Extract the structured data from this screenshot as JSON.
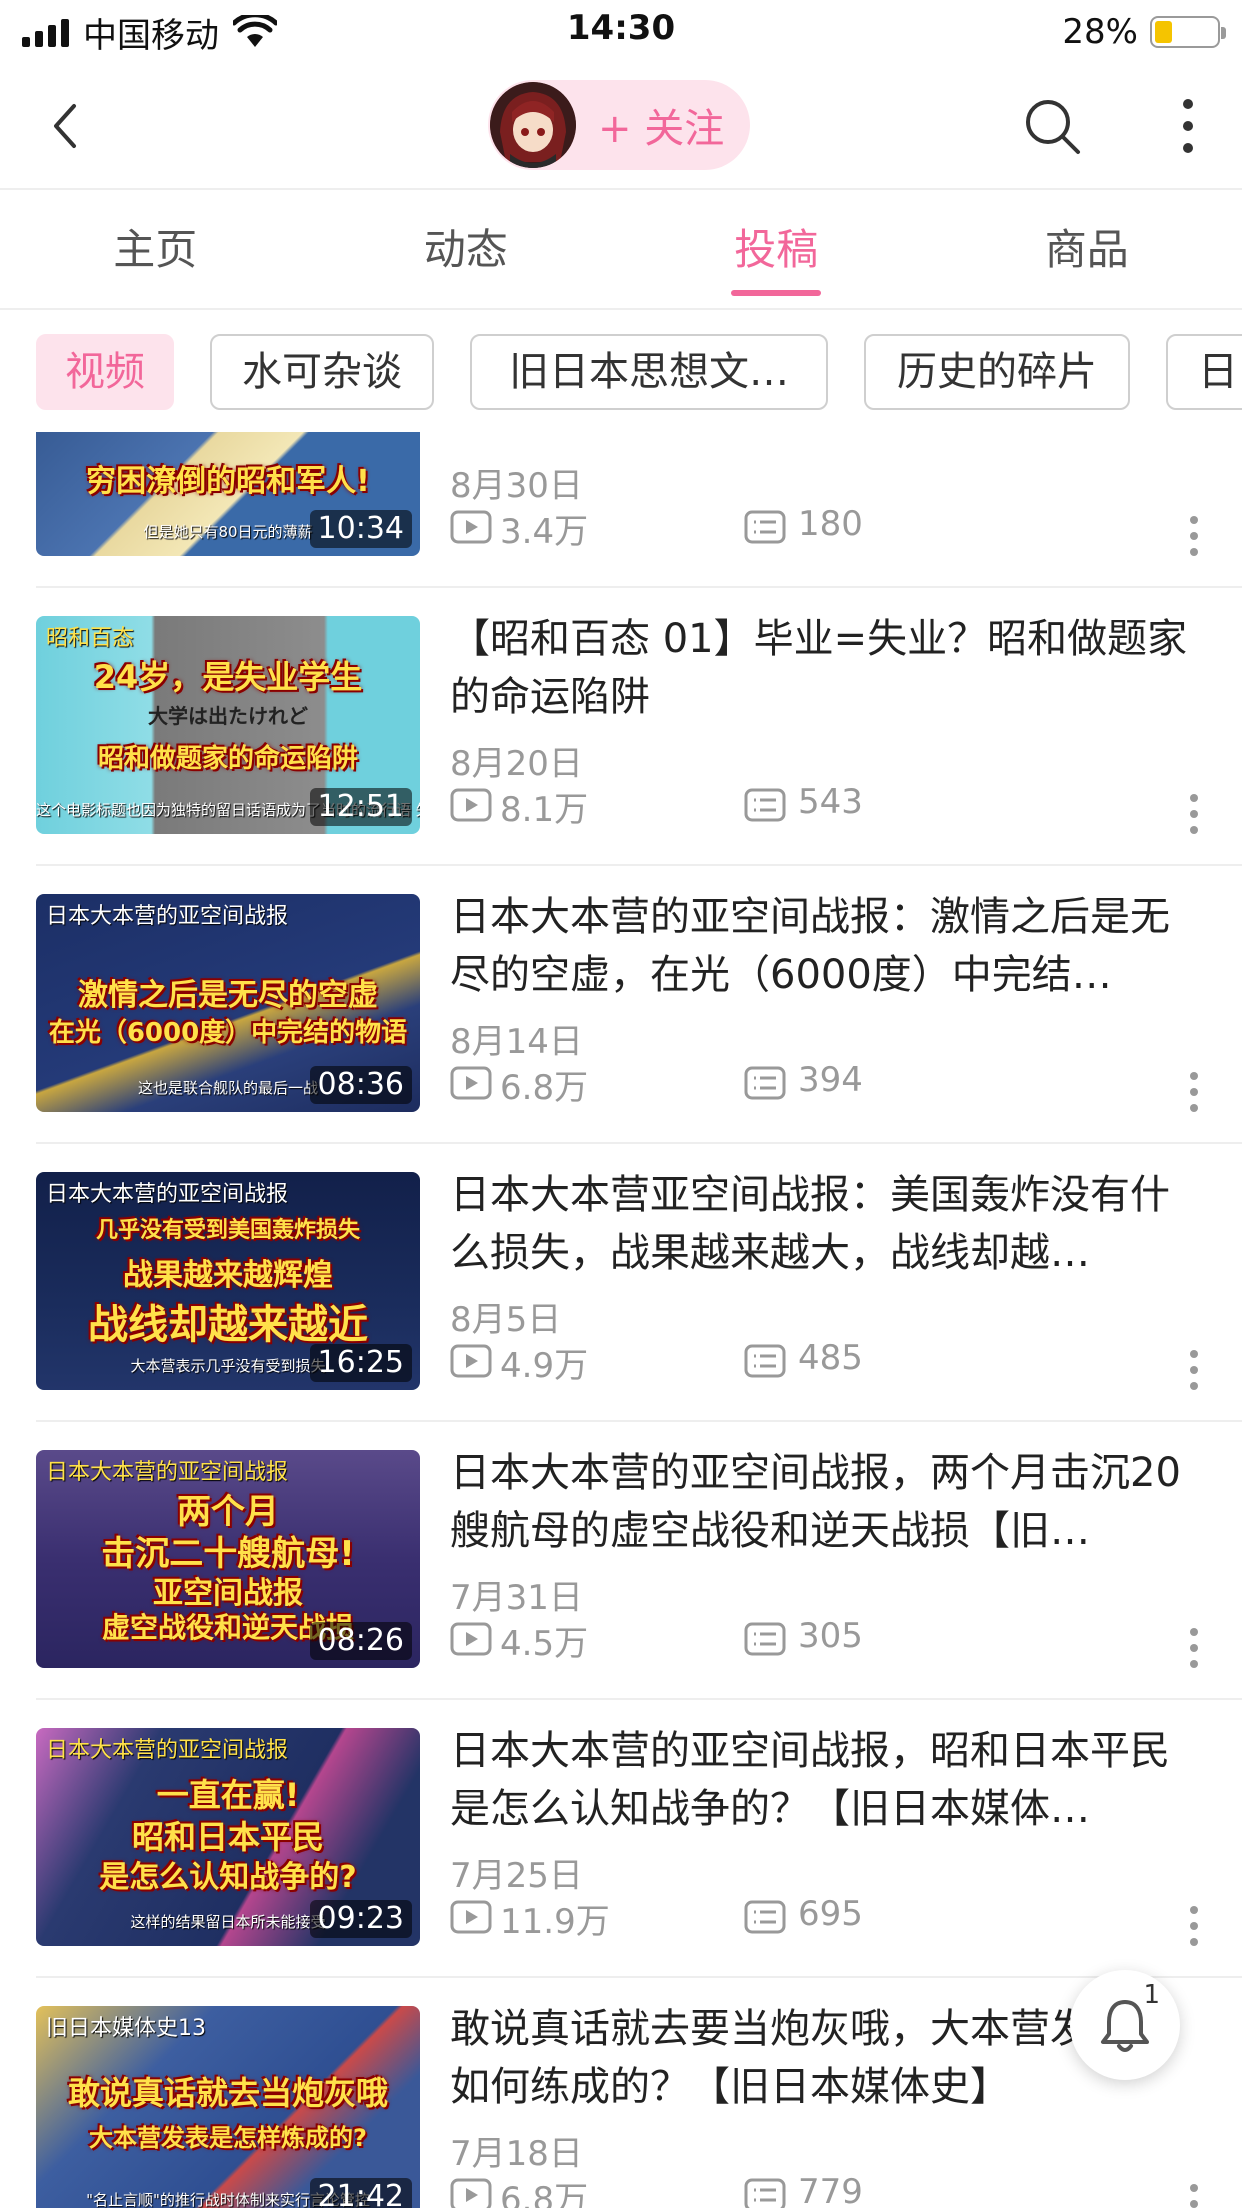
{
  "status_bar": {
    "carrier": "中国移动",
    "time": "14:30",
    "battery_percent": "28%",
    "battery_level": 0.28,
    "battery_color": "#f5c400"
  },
  "header": {
    "follow_label": "+ 关注",
    "back_icon": "chevron-left-icon",
    "search_icon": "search-icon",
    "more_icon": "more-vertical-icon",
    "accent_color": "#f2679a"
  },
  "tabs": [
    {
      "label": "主页",
      "active": false
    },
    {
      "label": "动态",
      "active": false
    },
    {
      "label": "投稿",
      "active": true
    },
    {
      "label": "商品",
      "active": false
    }
  ],
  "chips": [
    {
      "label": "视频",
      "active": true
    },
    {
      "label": "水可杂谈",
      "active": false
    },
    {
      "label": "旧日本思想文…",
      "active": false
    },
    {
      "label": "历史的碎片",
      "active": false
    },
    {
      "label": "日",
      "active": false
    }
  ],
  "videos": [
    {
      "thumb_tag": "",
      "thumb_lines": [
        "穷困潦倒的昭和军人!"
      ],
      "thumb_sub": "但是她只有80日元的薄薪",
      "duration": "10:34",
      "title": "",
      "date": "8月30日",
      "views": "3.4万",
      "comments": "180"
    },
    {
      "thumb_tag": "昭和百态",
      "thumb_lines": [
        "24岁，是失业学生",
        "大学は出たけれど",
        "昭和做题家的命运陷阱"
      ],
      "thumb_sub": "这个电影标题也因为独特的留日话语成为了当时的流行语 失排",
      "duration": "12:51",
      "title": "【昭和百态 01】毕业=失业？昭和做题家的命运陷阱",
      "date": "8月20日",
      "views": "8.1万",
      "comments": "543"
    },
    {
      "thumb_tag": "日本大本营的亚空间战报",
      "thumb_lines": [
        "激情之后是无尽的空虚",
        "在光（6000度）中完结的物语"
      ],
      "thumb_sub": "这也是联合舰队的最后一战",
      "duration": "08:36",
      "title": "日本大本营的亚空间战报：激情之后是无尽的空虚，在光（6000度）中完结…",
      "date": "8月14日",
      "views": "6.8万",
      "comments": "394"
    },
    {
      "thumb_tag": "日本大本营的亚空间战报",
      "thumb_lines": [
        "几乎没有受到美国轰炸损失",
        "战果越来越辉煌",
        "战线却越来越近"
      ],
      "thumb_sub": "大本营表示几乎没有受到损失",
      "duration": "16:25",
      "title": "日本大本营亚空间战报：美国轰炸没有什么损失，战果越来越大，战线却越…",
      "date": "8月5日",
      "views": "4.9万",
      "comments": "485"
    },
    {
      "thumb_tag": "日本大本营的亚空间战报",
      "thumb_lines": [
        "两个月",
        "击沉二十艘航母!",
        "亚空间战报",
        "虚空战役和逆天战损"
      ],
      "thumb_sub": "",
      "duration": "08:26",
      "title": "日本大本营的亚空间战报，两个月击沉20艘航母的虚空战役和逆天战损【旧…",
      "date": "7月31日",
      "views": "4.5万",
      "comments": "305"
    },
    {
      "thumb_tag": "日本大本营的亚空间战报",
      "thumb_lines": [
        "一直在赢!",
        "昭和日本平民",
        "是怎么认知战争的?"
      ],
      "thumb_sub": "这样的结果留日本所未能接受",
      "duration": "09:23",
      "title": "日本大本营的亚空间战报，昭和日本平民是怎么认知战争的？【旧日本媒体…",
      "date": "7月25日",
      "views": "11.9万",
      "comments": "695"
    },
    {
      "thumb_tag": "旧日本媒体史13",
      "thumb_lines": [
        "敢说真话就去当炮灰哦",
        "大本营发表是怎样炼成的?"
      ],
      "thumb_sub": "\"名止言顺\"的推行战时体制来实行言论管控",
      "duration": "21:42",
      "title": "敢说真话就去要当炮灰哦，大本营发表是如何练成的？【旧日本媒体史】",
      "date": "7月18日",
      "views": "6.8万",
      "comments": "779"
    }
  ],
  "notification": {
    "icon": "bell-icon",
    "count": "1"
  }
}
